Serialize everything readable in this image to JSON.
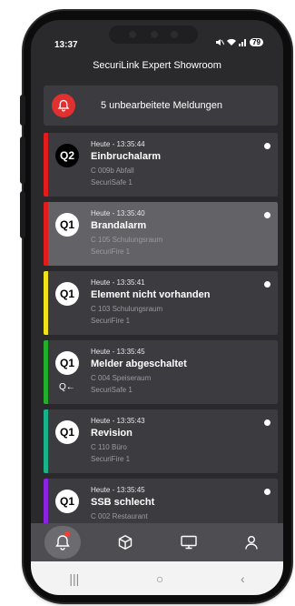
{
  "statusbar": {
    "time": "13:37",
    "battery": "79"
  },
  "app": {
    "title": "SecuriLink Expert Showroom"
  },
  "banner": {
    "text": "5 unbearbeitete Meldungen"
  },
  "messages": [
    {
      "prio": "Q2",
      "timestamp": "Heute - 13:35:44",
      "title": "Einbruchalarm",
      "location": "C 009b Abfall",
      "system": "SecuriSafe 1",
      "color": "#e31b1b",
      "unread": true,
      "selected": false
    },
    {
      "prio": "Q1",
      "timestamp": "Heute - 13:35:40",
      "title": "Brandalarm",
      "location": "C 105 Schulungsraum",
      "system": "SecuriFire 1",
      "color": "#e31b1b",
      "unread": true,
      "selected": true
    },
    {
      "prio": "Q1",
      "timestamp": "Heute - 13:35:41",
      "title": "Element nicht vorhanden",
      "location": "C 103 Schulungsraum",
      "system": "SecuriFire 1",
      "color": "#f2e21a",
      "unread": true,
      "selected": false
    },
    {
      "prio": "Q1",
      "timestamp": "Heute - 13:35:45",
      "title": "Melder abgeschaltet",
      "location": "C 004 Speiseraum",
      "system": "SecuriSafe 1",
      "color": "#22b02a",
      "unread": false,
      "selected": false,
      "sub_icon": "Q←"
    },
    {
      "prio": "Q1",
      "timestamp": "Heute - 13:35:43",
      "title": "Revision",
      "location": "C 110 Büro",
      "system": "SecuriFire 1",
      "color": "#17b28a",
      "unread": true,
      "selected": false
    },
    {
      "prio": "Q1",
      "timestamp": "Heute - 13:35:45",
      "title": "SSB schlecht",
      "location": "C 002 Restaurant",
      "system": "",
      "color": "#8a22e0",
      "unread": true,
      "selected": false
    }
  ],
  "tabs": [
    {
      "name": "alarms",
      "icon": "bell-icon",
      "active": true
    },
    {
      "name": "objects",
      "icon": "cube-icon",
      "active": false
    },
    {
      "name": "systems",
      "icon": "monitor-icon",
      "active": false
    },
    {
      "name": "profile",
      "icon": "user-icon",
      "active": false
    }
  ],
  "navbar": {
    "recents": "|||",
    "home": "○",
    "back": "‹"
  }
}
